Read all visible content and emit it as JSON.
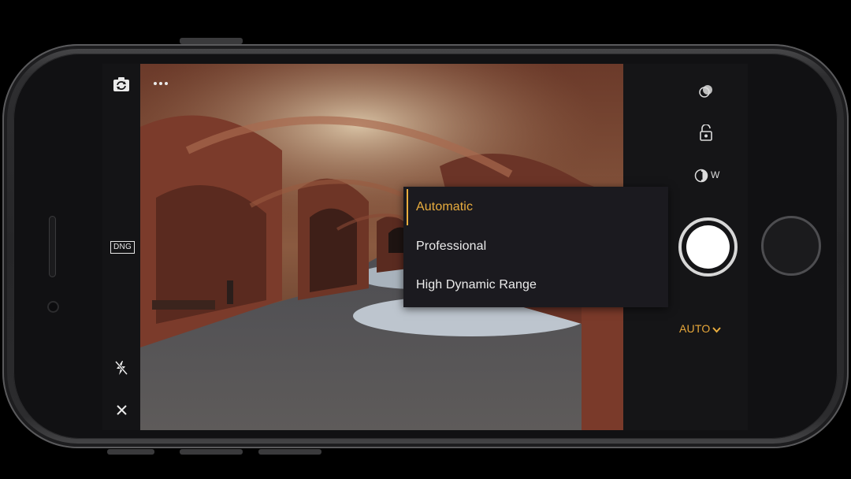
{
  "left_toolbar": {
    "switch_camera_icon": "camera-switch-icon",
    "more_icon": "more-dots-icon",
    "format_badge": "DNG",
    "flash_icon": "flash-off-icon",
    "close_icon": "close-icon"
  },
  "right_panel": {
    "icons": [
      "filter-circles-icon",
      "exposure-lock-icon",
      "lens-wide-icon"
    ],
    "lens_label": "W",
    "capture_mode_label": "AUTO",
    "capture_mode_chevron": "chevron-down-icon"
  },
  "capture_mode_menu": {
    "selected": "Automatic",
    "options": [
      "Automatic",
      "Professional",
      "High Dynamic Range"
    ]
  },
  "colors": {
    "accent": "#e9ad3e",
    "panel_bg": "#151517",
    "menu_bg": "#1b1a1f",
    "text": "#ececec"
  }
}
